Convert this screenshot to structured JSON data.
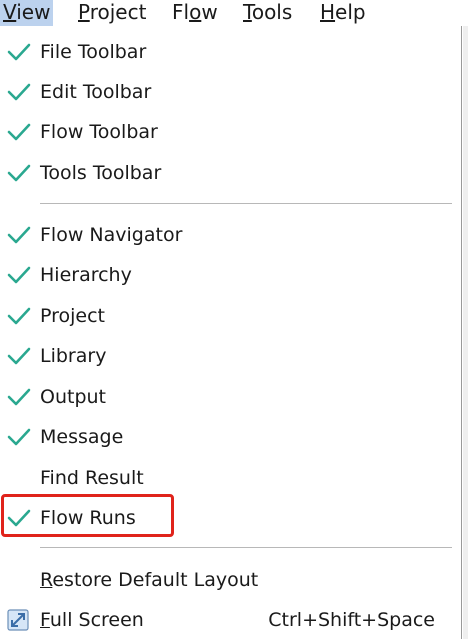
{
  "menubar": {
    "items": [
      {
        "mnemonic": "V",
        "rest": "iew"
      },
      {
        "mnemonic": "P",
        "rest": "roject"
      },
      {
        "prefix": "Fl",
        "mnemonic": "o",
        "rest": "w"
      },
      {
        "mnemonic": "T",
        "rest": "ools"
      },
      {
        "mnemonic": "H",
        "rest": "elp"
      }
    ]
  },
  "view_menu": {
    "toolbars": [
      {
        "label": "File Toolbar",
        "checked": true
      },
      {
        "label": "Edit Toolbar",
        "checked": true
      },
      {
        "label": "Flow Toolbar",
        "checked": true
      },
      {
        "label": "Tools Toolbar",
        "checked": true
      }
    ],
    "panels": [
      {
        "label": "Flow Navigator",
        "checked": true
      },
      {
        "label": "Hierarchy",
        "checked": true
      },
      {
        "label": "Project",
        "checked": true
      },
      {
        "label": "Library",
        "checked": true
      },
      {
        "label": "Output",
        "checked": true
      },
      {
        "label": "Message",
        "checked": true
      },
      {
        "label": "Find Result",
        "checked": false
      },
      {
        "label": "Flow Runs",
        "checked": true
      }
    ],
    "restore": {
      "mnemonic": "R",
      "rest": "estore Default Layout"
    },
    "fullscreen": {
      "mnemonic": "F",
      "rest": "ull Screen",
      "shortcut": "Ctrl+Shift+Space",
      "icon": "fullscreen-icon"
    }
  },
  "colors": {
    "check": "#2aa890",
    "highlight_box": "#e0231b",
    "active_menu_bg": "#bcd2ee"
  }
}
